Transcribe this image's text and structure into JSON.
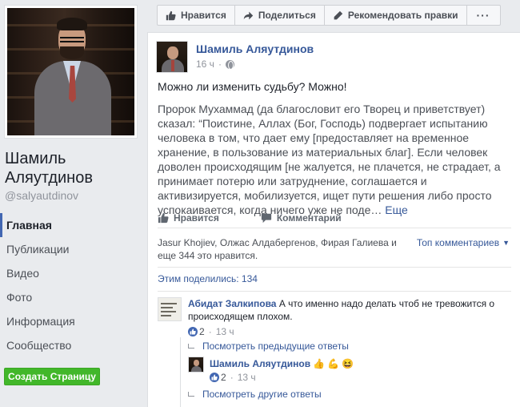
{
  "page": {
    "name": "Шамиль Аляутдинов",
    "handle": "@salyautdinov",
    "create_page_label": "Создать Страницу"
  },
  "nav": {
    "items": [
      {
        "label": "Главная",
        "active": true
      },
      {
        "label": "Публикации"
      },
      {
        "label": "Видео"
      },
      {
        "label": "Фото"
      },
      {
        "label": "Информация"
      },
      {
        "label": "Сообщество"
      }
    ]
  },
  "topbar": {
    "like_label": "Нравится",
    "share_label": "Поделиться",
    "suggest_label": "Рекомендовать правки",
    "more_label": "···"
  },
  "post": {
    "author": "Шамиль Аляутдинов",
    "time": "16 ч",
    "headline": "Можно ли изменить судьбу? Можно!",
    "body": "Пророк Мухаммад (да благословит его Творец и приветствует) сказал: “Поистине, Аллах (Бог, Господь) подвергает испытанию человека в том, что дает ему [предоставляет на временное хранение, в пользование из материальных благ]. Если человек доволен происходящим [не жалуется, не плачется, не страдает, а принимает потерю или затруднение, соглашается и активизируется, мобилизуется, ищет пути решения либо просто успокаивается, когда ничего уже не поде…",
    "more_label": "Еще",
    "like_action": "Нравится",
    "comment_action": "Комментарий",
    "likes_text": "Jasur Khojiev, Олжас Алдабергенов, Фирая Галиева и еще 344 это нравится.",
    "top_comments_label": "Топ комментариев",
    "shares_text": "Этим поделились: 134"
  },
  "comments": [
    {
      "author": "Абидат Залкипова",
      "text": "А что именно надо делать чтоб не тревожится о происходящем плохом.",
      "likes": "2",
      "time": "13 ч"
    }
  ],
  "replies": {
    "prev_label": "Посмотреть предыдущие ответы",
    "reply_author": "Шамиль Аляутдинов",
    "reply_emojis": [
      "👍",
      "💪",
      "😆"
    ],
    "reply_likes": "2",
    "reply_time": "13 ч",
    "other_label": "Посмотреть другие ответы"
  },
  "colors": {
    "link": "#365899",
    "accent": "#4267b2",
    "create_button": "#42b72a",
    "background": "#e9ebee"
  }
}
